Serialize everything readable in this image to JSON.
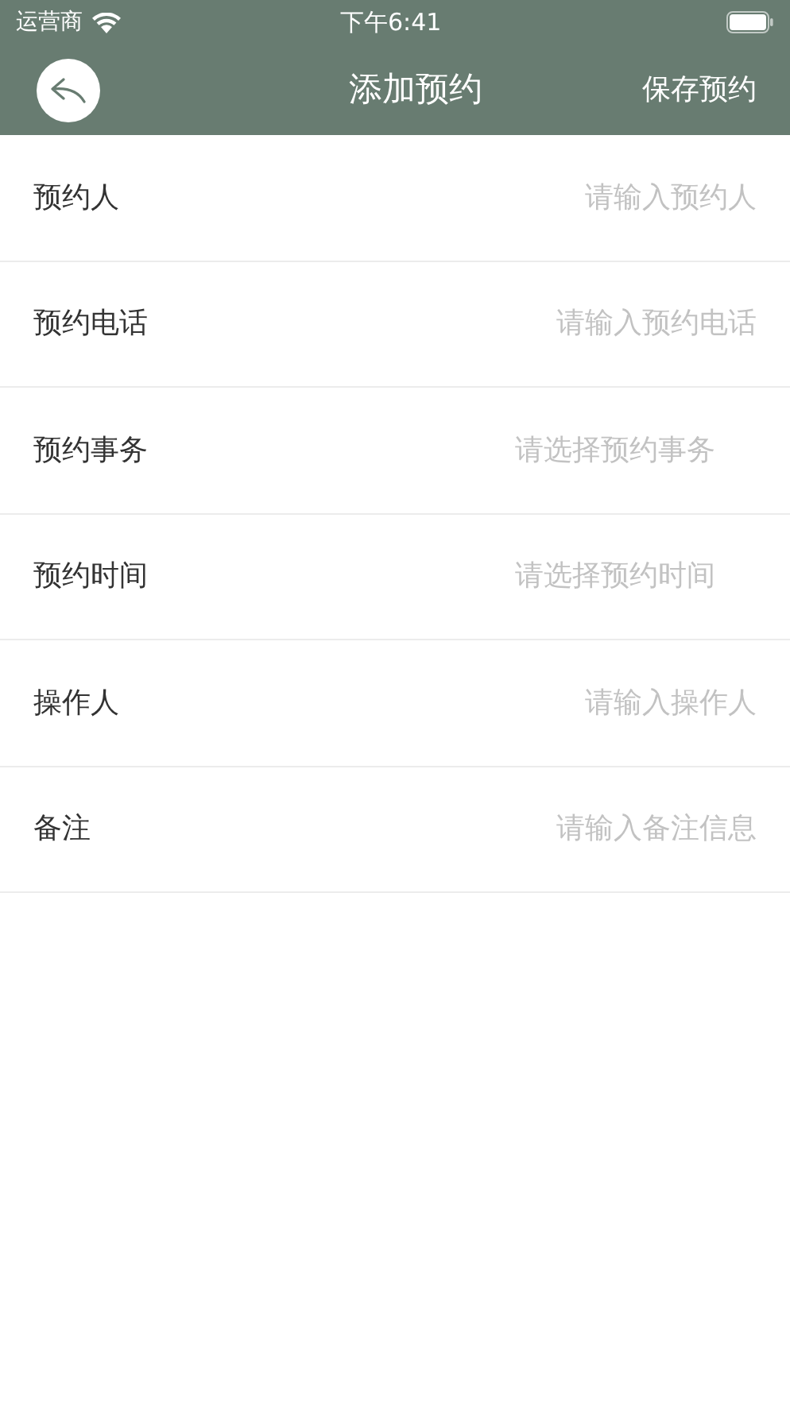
{
  "status_bar": {
    "carrier": "运营商",
    "time": "下午6:41"
  },
  "nav": {
    "title": "添加预约",
    "action": "保存预约"
  },
  "fields": [
    {
      "label": "预约人",
      "placeholder": "请输入预约人",
      "kind": "input"
    },
    {
      "label": "预约电话",
      "placeholder": "请输入预约电话",
      "kind": "input"
    },
    {
      "label": "预约事务",
      "placeholder": "请选择预约事务",
      "kind": "select"
    },
    {
      "label": "预约时间",
      "placeholder": "请选择预约时间",
      "kind": "select"
    },
    {
      "label": "操作人",
      "placeholder": "请输入操作人",
      "kind": "input"
    },
    {
      "label": "备注",
      "placeholder": "请输入备注信息",
      "kind": "input"
    }
  ]
}
